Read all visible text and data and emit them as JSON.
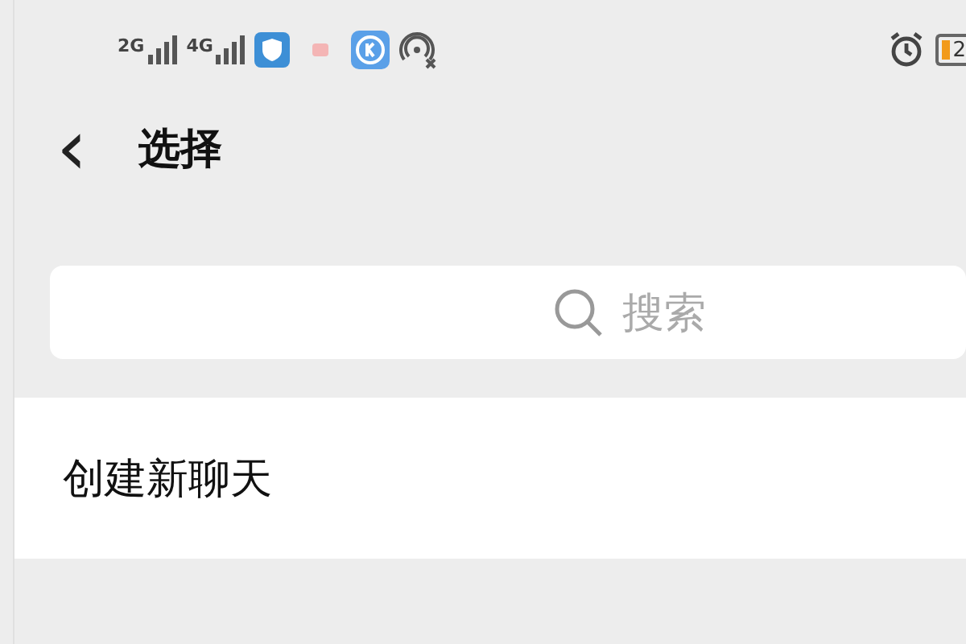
{
  "status_bar": {
    "signal_1": "2G",
    "signal_2": "4G",
    "battery": "2"
  },
  "header": {
    "back": "‹",
    "title": "选择"
  },
  "search": {
    "placeholder": "搜索"
  },
  "list": [
    {
      "label": "创建新聊天"
    }
  ]
}
